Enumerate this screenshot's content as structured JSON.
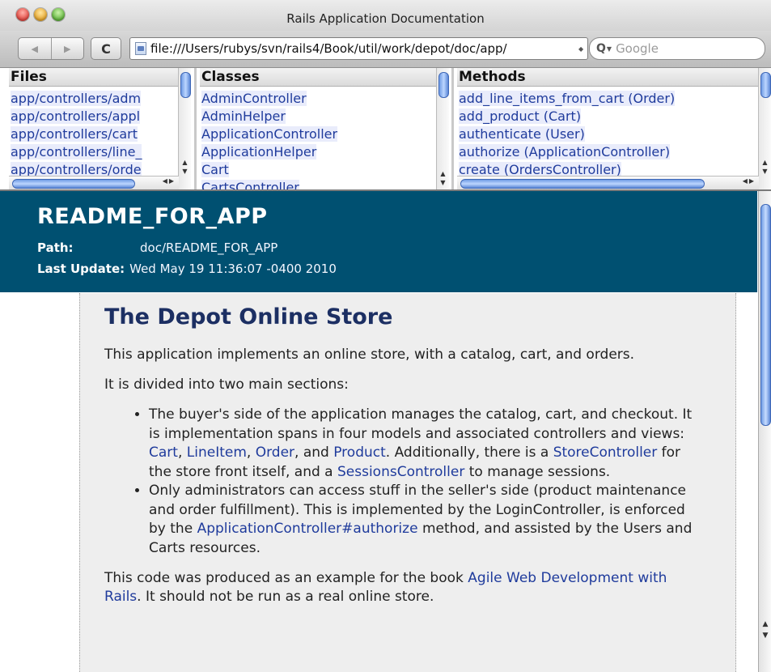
{
  "window": {
    "title": "Rails Application Documentation"
  },
  "toolbar": {
    "back_glyph": "◀",
    "forward_glyph": "▶",
    "reload_glyph": "C",
    "url": "file:///Users/rubys/svn/rails4/Book/util/work/depot/doc/app/",
    "search_placeholder": "Google"
  },
  "frames": {
    "files": {
      "heading": "Files",
      "items": [
        "app/controllers/adm",
        "app/controllers/appl",
        "app/controllers/cart",
        "app/controllers/line_",
        "app/controllers/orde"
      ]
    },
    "classes": {
      "heading": "Classes",
      "items": [
        "AdminController",
        "AdminHelper",
        "ApplicationController",
        "ApplicationHelper",
        "Cart",
        "CartsController"
      ]
    },
    "methods": {
      "heading": "Methods",
      "items": [
        "add_line_items_from_cart (Order)",
        "add_product (Cart)",
        "authenticate (User)",
        "authorize (ApplicationController)",
        "create (OrdersController)"
      ]
    }
  },
  "doc": {
    "title": "README_FOR_APP",
    "path_label": "Path:",
    "path_value": "doc/README_FOR_APP",
    "updated_label": "Last Update:",
    "updated_value": "Wed May 19 11:36:07 -0400 2010",
    "heading": "The Depot Online Store",
    "intro": "This application implements an online store, with a catalog, cart, and orders.",
    "sections_intro": "It is divided into two main sections:",
    "bullet1": {
      "t1": "The buyer's side of the application manages the catalog, cart, and checkout. It is implementation spans in four models and associated controllers and views: ",
      "link_cart": "Cart",
      "sep1": ", ",
      "link_lineitem": "LineItem",
      "sep2": ", ",
      "link_order": "Order",
      "sep3": ", and ",
      "link_product": "Product",
      "t2": ". Additionally, there is a ",
      "link_store": "StoreController",
      "t3": " for the store front itself, and a ",
      "link_sessions": "SessionsController",
      "t4": " to manage sessions."
    },
    "bullet2": {
      "t1": "Only administrators can access stuff in the seller's side (product maintenance and order fulfillment). This is implemented by the LoginController, is enforced by the ",
      "link_authorize": "ApplicationController#authorize",
      "t2": " method, and assisted by the Users and Carts resources."
    },
    "closing": {
      "t1": "This code was produced as an example for the book ",
      "link_book": "Agile Web Development with Rails",
      "t2": ". It should not be run as a real online store."
    }
  }
}
